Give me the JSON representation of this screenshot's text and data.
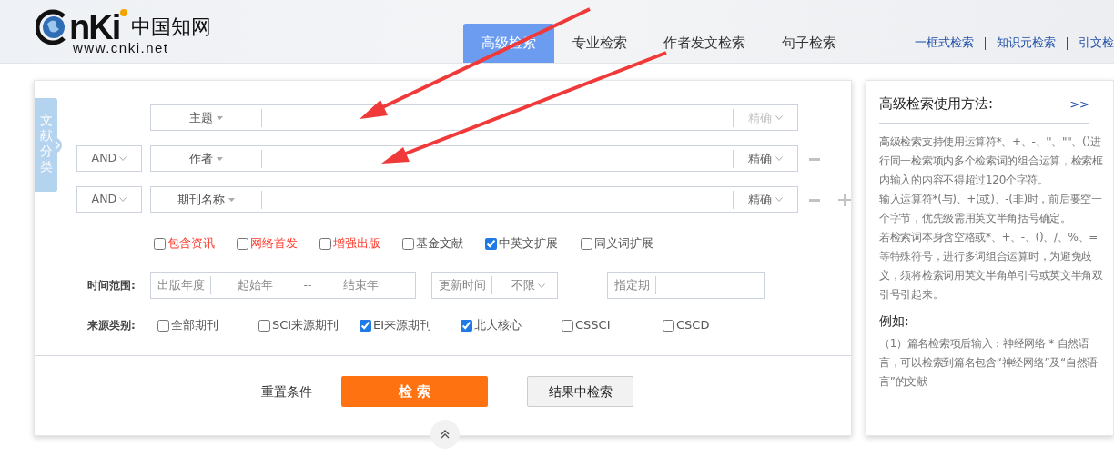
{
  "logo": {
    "mark": "nKi",
    "name": "中国知网",
    "url": "www.cnki.net"
  },
  "tabs": [
    {
      "label": "高级检索",
      "selected": true
    },
    {
      "label": "专业检索",
      "selected": false
    },
    {
      "label": "作者发文检索",
      "selected": false
    },
    {
      "label": "句子检索",
      "selected": false
    }
  ],
  "quick_links": [
    "一框式检索",
    "知识元检索",
    "引文检"
  ],
  "side_tab": "文献分类",
  "search_rows": [
    {
      "field": "主题",
      "match": "精确",
      "match_disabled": true,
      "removable": false,
      "addable": false
    },
    {
      "operator": "AND",
      "field": "作者",
      "match": "精确",
      "match_disabled": false,
      "removable": true,
      "addable": false
    },
    {
      "operator": "AND",
      "field": "期刊名称",
      "match": "精确",
      "match_disabled": false,
      "removable": true,
      "addable": true
    }
  ],
  "options": [
    {
      "label": "包含资讯",
      "checked": false,
      "color": "#ff3c2e"
    },
    {
      "label": "网络首发",
      "checked": false,
      "color": "#ff3c2e"
    },
    {
      "label": "增强出版",
      "checked": false,
      "color": "#ff3c2e"
    },
    {
      "label": "基金文献",
      "checked": false,
      "color": "#555555"
    },
    {
      "label": "中英文扩展",
      "checked": true,
      "color": "#555555"
    },
    {
      "label": "同义词扩展",
      "checked": false,
      "color": "#555555"
    }
  ],
  "time_range": {
    "label": "时间范围:",
    "year_label": "出版年度",
    "start_placeholder": "起始年",
    "separator": "--",
    "end_placeholder": "结束年",
    "update_label": "更新时间",
    "update_value": "不限",
    "issue_label": "指定期"
  },
  "sources": {
    "label": "来源类别:",
    "options": [
      {
        "label": "全部期刊",
        "checked": false
      },
      {
        "label": "SCI来源期刊",
        "checked": false
      },
      {
        "label": "EI来源期刊",
        "checked": true
      },
      {
        "label": "北大核心",
        "checked": true
      },
      {
        "label": "CSSCI",
        "checked": false
      },
      {
        "label": "CSCD",
        "checked": false
      }
    ]
  },
  "actions": {
    "reset": "重置条件",
    "search": "检 索",
    "within": "结果中检索"
  },
  "help": {
    "title": "高级检索使用方法:",
    "more": ">>",
    "paragraphs": [
      "高级检索支持使用运算符*、+、-、''、\"\"、()进行同一检索项内多个检索词的组合运算，检索框内输入的内容不得超过120个字符。",
      "输入运算符*(与)、+(或)、-(非)时，前后要空一个字节，优先级需用英文半角括号确定。",
      "若检索词本身含空格或*、+、-、()、/、%、=等特殊符号，进行多词组合运算时，为避免歧义，须将检索词用英文半角单引号或英文半角双引号引起来。"
    ],
    "example_title": "例如:",
    "examples": [
      "（1）篇名检索项后输入：神经网络 * 自然语言，可以检索到篇名包含“神经网络”及“自然语言”的文献"
    ]
  }
}
